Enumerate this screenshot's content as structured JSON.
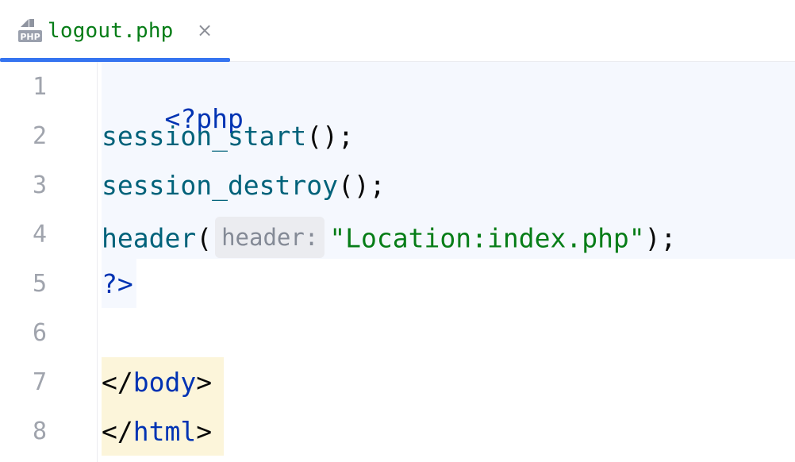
{
  "tab": {
    "icon_label": "PHP",
    "filename": "logout.php",
    "close_symbol": "×"
  },
  "editor": {
    "line_numbers": [
      "1",
      "2",
      "3",
      "4",
      "5",
      "6",
      "7",
      "8"
    ],
    "lines": {
      "l1": {
        "kw": "<?php"
      },
      "l2": {
        "fn": "session_start",
        "rest": "();"
      },
      "l3": {
        "fn": "session_destroy",
        "rest": "();"
      },
      "l4": {
        "fn": "header",
        "open": "(",
        "hint": "header:",
        "str": "\"Location:index.php\"",
        "close": ");"
      },
      "l5": {
        "kw": "?>"
      },
      "l7": {
        "open": "</",
        "tag": "body",
        "close": ">"
      },
      "l8": {
        "open": "</",
        "tag": "html",
        "close": ">"
      }
    }
  },
  "colors": {
    "accent": "#3574f0",
    "keyword": "#0033b3",
    "function": "#00627a",
    "string": "#067d17",
    "php_block_bg": "#f5f8fe",
    "html_block_bg": "#fcf5da"
  }
}
